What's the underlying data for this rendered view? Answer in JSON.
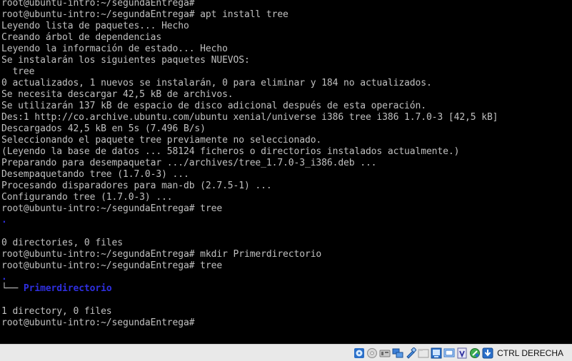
{
  "terminal": {
    "lines": [
      {
        "text": "root@ubuntu-intro:~/segundaEntrega#",
        "style": "normal"
      },
      {
        "text": "root@ubuntu-intro:~/segundaEntrega# apt install tree",
        "style": "normal"
      },
      {
        "text": "Leyendo lista de paquetes... Hecho",
        "style": "normal"
      },
      {
        "text": "Creando árbol de dependencias",
        "style": "normal"
      },
      {
        "text": "Leyendo la información de estado... Hecho",
        "style": "normal"
      },
      {
        "text": "Se instalarán los siguientes paquetes NUEVOS:",
        "style": "normal"
      },
      {
        "text": "  tree",
        "style": "normal"
      },
      {
        "text": "0 actualizados, 1 nuevos se instalarán, 0 para eliminar y 184 no actualizados.",
        "style": "normal"
      },
      {
        "text": "Se necesita descargar 42,5 kB de archivos.",
        "style": "normal"
      },
      {
        "text": "Se utilizarán 137 kB de espacio de disco adicional después de esta operación.",
        "style": "normal"
      },
      {
        "text": "Des:1 http://co.archive.ubuntu.com/ubuntu xenial/universe i386 tree i386 1.7.0-3 [42,5 kB]",
        "style": "normal"
      },
      {
        "text": "Descargados 42,5 kB en 5s (7.496 B/s)",
        "style": "normal"
      },
      {
        "text": "Seleccionando el paquete tree previamente no seleccionado.",
        "style": "normal"
      },
      {
        "text": "(Leyendo la base de datos ... 58124 ficheros o directorios instalados actualmente.)",
        "style": "normal"
      },
      {
        "text": "Preparando para desempaquetar .../archives/tree_1.7.0-3_i386.deb ...",
        "style": "normal"
      },
      {
        "text": "Desempaquetando tree (1.7.0-3) ...",
        "style": "normal"
      },
      {
        "text": "Procesando disparadores para man-db (2.7.5-1) ...",
        "style": "normal"
      },
      {
        "text": "Configurando tree (1.7.0-3) ...",
        "style": "normal"
      },
      {
        "text": "root@ubuntu-intro:~/segundaEntrega# tree",
        "style": "normal"
      },
      {
        "text": ".",
        "style": "blue"
      },
      {
        "text": "",
        "style": "normal"
      },
      {
        "text": "0 directories, 0 files",
        "style": "normal"
      },
      {
        "text": "root@ubuntu-intro:~/segundaEntrega# mkdir Primerdirectorio",
        "style": "normal"
      },
      {
        "text": "root@ubuntu-intro:~/segundaEntrega# tree",
        "style": "normal"
      },
      {
        "text": ".",
        "style": "blue"
      },
      {
        "text": "Primerdirectorio",
        "style": "tree",
        "prefix": "└── "
      },
      {
        "text": "",
        "style": "normal"
      },
      {
        "text": "1 directory, 0 files",
        "style": "normal"
      },
      {
        "text": "root@ubuntu-intro:~/segundaEntrega#",
        "style": "normal"
      }
    ],
    "colors": {
      "background": "#000000",
      "foreground": "#c0c0c0",
      "directory": "#2f2fe0"
    }
  },
  "statusbar": {
    "host_key_label": "CTRL DERECHA",
    "icons": [
      "optical-drive-icon",
      "hard-disk-icon",
      "audio-icon",
      "network-icon",
      "usb-icon",
      "shared-folders-icon",
      "display-icon",
      "screen-capture-icon",
      "virtualization-icon",
      "mouse-integration-icon",
      "keyboard-capture-icon"
    ]
  }
}
